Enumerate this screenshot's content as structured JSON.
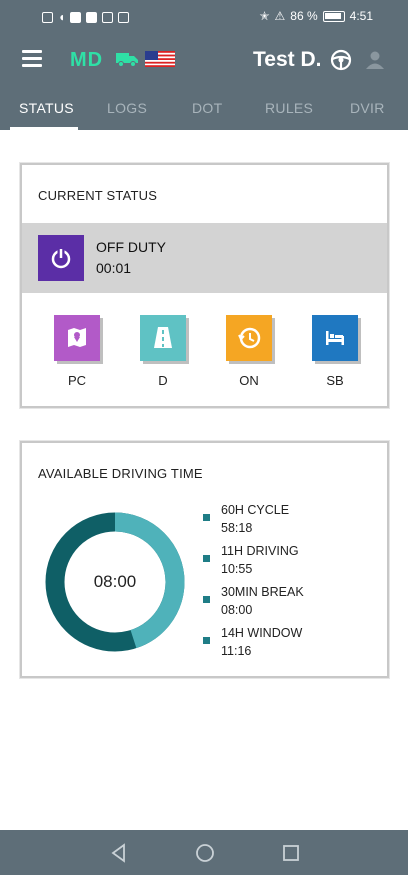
{
  "status_bar": {
    "battery_percent": "86 %",
    "time": "4:51"
  },
  "app_bar": {
    "brand": "MD",
    "driver_name": "Test D."
  },
  "tabs": [
    {
      "label": "STATUS",
      "active": true
    },
    {
      "label": "LOGS",
      "active": false
    },
    {
      "label": "DOT",
      "active": false
    },
    {
      "label": "RULES",
      "active": false
    },
    {
      "label": "DVIR",
      "active": false
    }
  ],
  "current_status": {
    "title": "CURRENT STATUS",
    "state": "OFF DUTY",
    "duration": "00:01",
    "buttons": [
      {
        "label": "PC",
        "icon": "map-pin-icon",
        "color": "#b25ac8"
      },
      {
        "label": "D",
        "icon": "road-icon",
        "color": "#5fc2c4"
      },
      {
        "label": "ON",
        "icon": "clock-history-icon",
        "color": "#f5a623"
      },
      {
        "label": "SB",
        "icon": "bed-icon",
        "color": "#1f78c1"
      }
    ]
  },
  "driving_time": {
    "title": "AVAILABLE DRIVING TIME",
    "center_value": "08:00",
    "ring_fraction": 0.45,
    "legend": [
      {
        "label": "60H CYCLE",
        "value": "58:18"
      },
      {
        "label": "11H DRIVING",
        "value": "10:55"
      },
      {
        "label": "30MIN BREAK",
        "value": "08:00"
      },
      {
        "label": "14H WINDOW",
        "value": "11:16"
      }
    ]
  },
  "colors": {
    "primary": "#5e6e78",
    "accent_green": "#2fe0a6",
    "power_button": "#5b2ea6",
    "ring_dark": "#0f5f66",
    "ring_light": "#4fb2ba"
  }
}
